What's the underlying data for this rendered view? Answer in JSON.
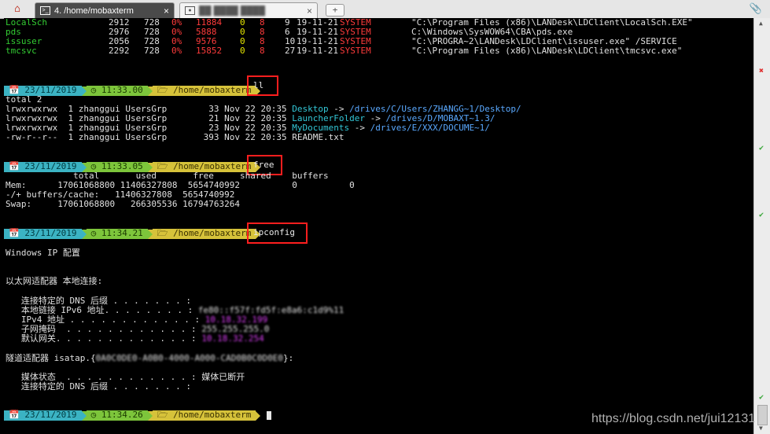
{
  "tabs": [
    {
      "label": "4. /home/mobaxterm",
      "close": "×"
    },
    {
      "label": "(blurred)",
      "close": "×"
    }
  ],
  "newtab_label": "+",
  "process_rows": [
    {
      "name": "LocalSch",
      "pid": "2912",
      "ppid": "728",
      "cpu": "0%",
      "mem": "11884",
      "a": "0",
      "b": "8",
      "c": "9",
      "date": "19-11-21",
      "user": "SYSTEM",
      "path": "\"C:\\Program Files (x86)\\LANDesk\\LDClient\\LocalSch.EXE\""
    },
    {
      "name": "pds",
      "pid": "2976",
      "ppid": "728",
      "cpu": "0%",
      "mem": "5888",
      "a": "0",
      "b": "8",
      "c": "6",
      "date": "19-11-21",
      "user": "SYSTEM",
      "path": "C:\\Windows\\SysWOW64\\CBA\\pds.exe"
    },
    {
      "name": "issuser",
      "pid": "2056",
      "ppid": "728",
      "cpu": "0%",
      "mem": "9576",
      "a": "0",
      "b": "8",
      "c": "10",
      "date": "19-11-21",
      "user": "SYSTEM",
      "path": "\"C:\\PROGRA~2\\LANDesk\\LDClient\\issuser.exe\" /SERVICE"
    },
    {
      "name": "tmcsvc",
      "pid": "2292",
      "ppid": "728",
      "cpu": "0%",
      "mem": "15852",
      "a": "0",
      "b": "8",
      "c": "27",
      "date": "19-11-21",
      "user": "SYSTEM",
      "path": "\"C:\\Program Files (x86)\\LANDesk\\LDClient\\tmcsvc.exe\""
    }
  ],
  "prompts": [
    {
      "date": "23/11/2019",
      "time": "11:33.00",
      "dir": "/home/mobaxterm",
      "cmd": "ll"
    },
    {
      "date": "23/11/2019",
      "time": "11:33.05",
      "dir": "/home/mobaxterm",
      "cmd": "free"
    },
    {
      "date": "23/11/2019",
      "time": "11:34.21",
      "dir": "/home/mobaxterm",
      "cmd": "ipconfig"
    },
    {
      "date": "23/11/2019",
      "time": "11:34.26",
      "dir": "/home/mobaxterm",
      "cmd": ""
    }
  ],
  "ll": {
    "total": "total 2",
    "rows": [
      {
        "perm": "lrwxrwxrwx",
        "links": "1",
        "owner": "zhanggui",
        "group": "UsersGrp",
        "size": "33",
        "date": "Nov 22 20:35",
        "name": "Desktop",
        "target": "/drives/C/Users/ZHANGG~1/Desktop/"
      },
      {
        "perm": "lrwxrwxrwx",
        "links": "1",
        "owner": "zhanggui",
        "group": "UsersGrp",
        "size": "21",
        "date": "Nov 22 20:35",
        "name": "LauncherFolder",
        "target": "/drives/D/MOBAXT~1.3/"
      },
      {
        "perm": "lrwxrwxrwx",
        "links": "1",
        "owner": "zhanggui",
        "group": "UsersGrp",
        "size": "23",
        "date": "Nov 22 20:35",
        "name": "MyDocuments",
        "target": "/drives/E/XXX/DOCUME~1/"
      },
      {
        "perm": "-rw-r--r--",
        "links": "1",
        "owner": "zhanggui",
        "group": "UsersGrp",
        "size": "393",
        "date": "Nov 22 20:35",
        "name": "README.txt",
        "target": ""
      }
    ]
  },
  "free": {
    "header": "             total       used       free     shared    buffers",
    "mem": "Mem:      17061068800 11406327808  5654740992          0          0",
    "buffers": "-/+ buffers/cache:   11406327808  5654740992",
    "swap": "Swap:     17061068800   266305536 16794763264"
  },
  "ipconfig": {
    "title": "Windows IP 配置",
    "adapter": "以太网适配器 本地连接:",
    "dns_suffix": "   连接特定的 DNS 后缀 . . . . . . . :",
    "ipv6": "   本地链接 IPv6 地址. . . . . . . . :",
    "ipv4": "   IPv4 地址 . . . . . . . . . . . . :",
    "mask": "   子网掩码  . . . . . . . . . . . . :",
    "gateway": "   默认网关. . . . . . . . . . . . . :",
    "ipv6_val": "fe80::f57f:fd5f:e8a6:c1d9%11",
    "ipv4_val": "10.18.32.199",
    "mask_val": "255.255.255.0",
    "gateway_val": "10.18.32.254",
    "tunnel": "隧道适配器 isatap.{",
    "tunnel_tail": "}:",
    "tunnel_blur": "0A0C0DE0-A0B0-4000-A000-CAD0B0C0D0E0",
    "media": "   媒体状态  . . . . . . . . . . . . : 媒体已断开",
    "dns_suffix2": "   连接特定的 DNS 后缀 . . . . . . . :"
  },
  "watermark": "https://blog.csdn.net/jui12131",
  "colors": {
    "accent_red": "#ff1e1e",
    "seg_cyan": "#3bb3c3",
    "seg_green": "#7dc53b",
    "seg_yellow": "#d6c23a"
  }
}
